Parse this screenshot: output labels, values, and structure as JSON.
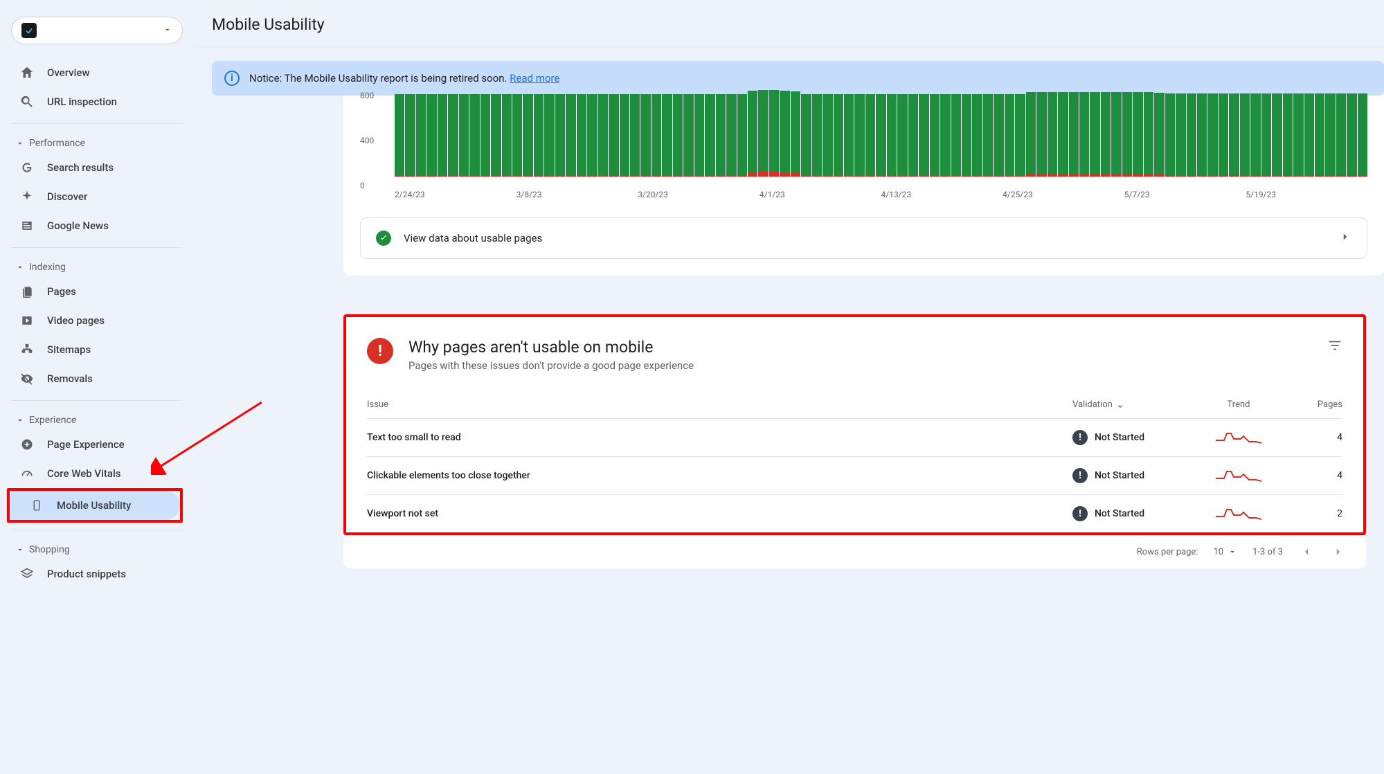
{
  "page_title": "Mobile Usability",
  "notice": {
    "prefix": "Notice: ",
    "text": "The Mobile Usability report is being retired soon. ",
    "link": "Read more"
  },
  "sidebar": {
    "overview": "Overview",
    "url_inspection": "URL inspection",
    "groups": {
      "performance": "Performance",
      "indexing": "Indexing",
      "experience": "Experience",
      "shopping": "Shopping"
    },
    "search_results": "Search results",
    "discover": "Discover",
    "google_news": "Google News",
    "pages": "Pages",
    "video_pages": "Video pages",
    "sitemaps": "Sitemaps",
    "removals": "Removals",
    "page_experience": "Page Experience",
    "core_web_vitals": "Core Web Vitals",
    "mobile_usability": "Mobile Usability",
    "product_snippets": "Product snippets"
  },
  "usable_row_label": "View data about usable pages",
  "issues": {
    "title": "Why pages aren't usable on mobile",
    "subtitle": "Pages with these issues don't provide a good page experience",
    "headers": {
      "issue": "Issue",
      "validation": "Validation",
      "trend": "Trend",
      "pages": "Pages"
    },
    "rows": [
      {
        "issue": "Text too small to read",
        "validation": "Not Started",
        "pages": "4"
      },
      {
        "issue": "Clickable elements too close together",
        "validation": "Not Started",
        "pages": "4"
      },
      {
        "issue": "Viewport not set",
        "validation": "Not Started",
        "pages": "2"
      }
    ]
  },
  "pager": {
    "rows_label": "Rows per page:",
    "rows_value": "10",
    "range": "1-3 of 3"
  },
  "chart_data": {
    "type": "bar",
    "ylabel": "",
    "ylim": [
      0,
      800
    ],
    "yticks": [
      0,
      400,
      800
    ],
    "x_ticks": [
      "2/24/23",
      "3/8/23",
      "3/20/23",
      "4/1/23",
      "4/13/23",
      "4/25/23",
      "5/7/23",
      "5/19/23"
    ],
    "series": [
      {
        "name": "usable",
        "color": "#1e8e3e"
      },
      {
        "name": "not_usable",
        "color": "#d93025"
      }
    ],
    "columns": [
      {
        "g": 800,
        "r": 6
      },
      {
        "g": 800,
        "r": 6
      },
      {
        "g": 800,
        "r": 6
      },
      {
        "g": 800,
        "r": 6
      },
      {
        "g": 800,
        "r": 6
      },
      {
        "g": 800,
        "r": 6
      },
      {
        "g": 800,
        "r": 6
      },
      {
        "g": 800,
        "r": 6
      },
      {
        "g": 800,
        "r": 6
      },
      {
        "g": 800,
        "r": 6
      },
      {
        "g": 800,
        "r": 6
      },
      {
        "g": 800,
        "r": 6
      },
      {
        "g": 800,
        "r": 6
      },
      {
        "g": 800,
        "r": 6
      },
      {
        "g": 800,
        "r": 6
      },
      {
        "g": 800,
        "r": 6
      },
      {
        "g": 800,
        "r": 6
      },
      {
        "g": 800,
        "r": 6
      },
      {
        "g": 800,
        "r": 6
      },
      {
        "g": 800,
        "r": 6
      },
      {
        "g": 800,
        "r": 6
      },
      {
        "g": 800,
        "r": 6
      },
      {
        "g": 800,
        "r": 6
      },
      {
        "g": 800,
        "r": 6
      },
      {
        "g": 800,
        "r": 6
      },
      {
        "g": 800,
        "r": 6
      },
      {
        "g": 800,
        "r": 6
      },
      {
        "g": 800,
        "r": 6
      },
      {
        "g": 800,
        "r": 6
      },
      {
        "g": 800,
        "r": 6
      },
      {
        "g": 800,
        "r": 6
      },
      {
        "g": 800,
        "r": 6
      },
      {
        "g": 800,
        "r": 6
      },
      {
        "g": 800,
        "r": 40
      },
      {
        "g": 800,
        "r": 50
      },
      {
        "g": 800,
        "r": 45
      },
      {
        "g": 800,
        "r": 40
      },
      {
        "g": 800,
        "r": 35
      },
      {
        "g": 800,
        "r": 10
      },
      {
        "g": 800,
        "r": 10
      },
      {
        "g": 800,
        "r": 10
      },
      {
        "g": 800,
        "r": 10
      },
      {
        "g": 800,
        "r": 10
      },
      {
        "g": 800,
        "r": 10
      },
      {
        "g": 800,
        "r": 10
      },
      {
        "g": 800,
        "r": 10
      },
      {
        "g": 800,
        "r": 10
      },
      {
        "g": 800,
        "r": 10
      },
      {
        "g": 800,
        "r": 10
      },
      {
        "g": 800,
        "r": 10
      },
      {
        "g": 800,
        "r": 10
      },
      {
        "g": 800,
        "r": 10
      },
      {
        "g": 800,
        "r": 10
      },
      {
        "g": 800,
        "r": 10
      },
      {
        "g": 800,
        "r": 10
      },
      {
        "g": 800,
        "r": 10
      },
      {
        "g": 800,
        "r": 10
      },
      {
        "g": 800,
        "r": 10
      },
      {
        "g": 800,
        "r": 10
      },
      {
        "g": 800,
        "r": 25
      },
      {
        "g": 800,
        "r": 25
      },
      {
        "g": 800,
        "r": 25
      },
      {
        "g": 800,
        "r": 30
      },
      {
        "g": 800,
        "r": 30
      },
      {
        "g": 800,
        "r": 25
      },
      {
        "g": 800,
        "r": 30
      },
      {
        "g": 800,
        "r": 30
      },
      {
        "g": 800,
        "r": 30
      },
      {
        "g": 800,
        "r": 30
      },
      {
        "g": 800,
        "r": 30
      },
      {
        "g": 800,
        "r": 25
      },
      {
        "g": 800,
        "r": 20
      },
      {
        "g": 800,
        "r": 15
      },
      {
        "g": 800,
        "r": 14
      },
      {
        "g": 800,
        "r": 12
      },
      {
        "g": 800,
        "r": 12
      },
      {
        "g": 800,
        "r": 12
      },
      {
        "g": 800,
        "r": 12
      },
      {
        "g": 800,
        "r": 12
      },
      {
        "g": 800,
        "r": 12
      },
      {
        "g": 800,
        "r": 12
      },
      {
        "g": 800,
        "r": 12
      },
      {
        "g": 800,
        "r": 12
      },
      {
        "g": 800,
        "r": 12
      },
      {
        "g": 800,
        "r": 12
      },
      {
        "g": 800,
        "r": 12
      },
      {
        "g": 800,
        "r": 12
      },
      {
        "g": 800,
        "r": 12
      },
      {
        "g": 800,
        "r": 12
      },
      {
        "g": 800,
        "r": 12
      },
      {
        "g": 800,
        "r": 12
      }
    ]
  }
}
